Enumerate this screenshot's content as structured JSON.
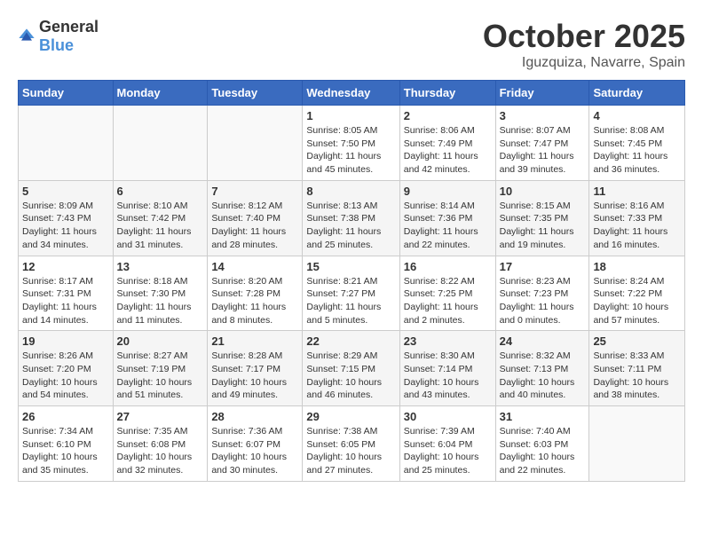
{
  "header": {
    "logo_general": "General",
    "logo_blue": "Blue",
    "month": "October 2025",
    "location": "Iguzquiza, Navarre, Spain"
  },
  "weekdays": [
    "Sunday",
    "Monday",
    "Tuesday",
    "Wednesday",
    "Thursday",
    "Friday",
    "Saturday"
  ],
  "weeks": [
    [
      {
        "day": "",
        "info": ""
      },
      {
        "day": "",
        "info": ""
      },
      {
        "day": "",
        "info": ""
      },
      {
        "day": "1",
        "info": "Sunrise: 8:05 AM\nSunset: 7:50 PM\nDaylight: 11 hours\nand 45 minutes."
      },
      {
        "day": "2",
        "info": "Sunrise: 8:06 AM\nSunset: 7:49 PM\nDaylight: 11 hours\nand 42 minutes."
      },
      {
        "day": "3",
        "info": "Sunrise: 8:07 AM\nSunset: 7:47 PM\nDaylight: 11 hours\nand 39 minutes."
      },
      {
        "day": "4",
        "info": "Sunrise: 8:08 AM\nSunset: 7:45 PM\nDaylight: 11 hours\nand 36 minutes."
      }
    ],
    [
      {
        "day": "5",
        "info": "Sunrise: 8:09 AM\nSunset: 7:43 PM\nDaylight: 11 hours\nand 34 minutes."
      },
      {
        "day": "6",
        "info": "Sunrise: 8:10 AM\nSunset: 7:42 PM\nDaylight: 11 hours\nand 31 minutes."
      },
      {
        "day": "7",
        "info": "Sunrise: 8:12 AM\nSunset: 7:40 PM\nDaylight: 11 hours\nand 28 minutes."
      },
      {
        "day": "8",
        "info": "Sunrise: 8:13 AM\nSunset: 7:38 PM\nDaylight: 11 hours\nand 25 minutes."
      },
      {
        "day": "9",
        "info": "Sunrise: 8:14 AM\nSunset: 7:36 PM\nDaylight: 11 hours\nand 22 minutes."
      },
      {
        "day": "10",
        "info": "Sunrise: 8:15 AM\nSunset: 7:35 PM\nDaylight: 11 hours\nand 19 minutes."
      },
      {
        "day": "11",
        "info": "Sunrise: 8:16 AM\nSunset: 7:33 PM\nDaylight: 11 hours\nand 16 minutes."
      }
    ],
    [
      {
        "day": "12",
        "info": "Sunrise: 8:17 AM\nSunset: 7:31 PM\nDaylight: 11 hours\nand 14 minutes."
      },
      {
        "day": "13",
        "info": "Sunrise: 8:18 AM\nSunset: 7:30 PM\nDaylight: 11 hours\nand 11 minutes."
      },
      {
        "day": "14",
        "info": "Sunrise: 8:20 AM\nSunset: 7:28 PM\nDaylight: 11 hours\nand 8 minutes."
      },
      {
        "day": "15",
        "info": "Sunrise: 8:21 AM\nSunset: 7:27 PM\nDaylight: 11 hours\nand 5 minutes."
      },
      {
        "day": "16",
        "info": "Sunrise: 8:22 AM\nSunset: 7:25 PM\nDaylight: 11 hours\nand 2 minutes."
      },
      {
        "day": "17",
        "info": "Sunrise: 8:23 AM\nSunset: 7:23 PM\nDaylight: 11 hours\nand 0 minutes."
      },
      {
        "day": "18",
        "info": "Sunrise: 8:24 AM\nSunset: 7:22 PM\nDaylight: 10 hours\nand 57 minutes."
      }
    ],
    [
      {
        "day": "19",
        "info": "Sunrise: 8:26 AM\nSunset: 7:20 PM\nDaylight: 10 hours\nand 54 minutes."
      },
      {
        "day": "20",
        "info": "Sunrise: 8:27 AM\nSunset: 7:19 PM\nDaylight: 10 hours\nand 51 minutes."
      },
      {
        "day": "21",
        "info": "Sunrise: 8:28 AM\nSunset: 7:17 PM\nDaylight: 10 hours\nand 49 minutes."
      },
      {
        "day": "22",
        "info": "Sunrise: 8:29 AM\nSunset: 7:15 PM\nDaylight: 10 hours\nand 46 minutes."
      },
      {
        "day": "23",
        "info": "Sunrise: 8:30 AM\nSunset: 7:14 PM\nDaylight: 10 hours\nand 43 minutes."
      },
      {
        "day": "24",
        "info": "Sunrise: 8:32 AM\nSunset: 7:13 PM\nDaylight: 10 hours\nand 40 minutes."
      },
      {
        "day": "25",
        "info": "Sunrise: 8:33 AM\nSunset: 7:11 PM\nDaylight: 10 hours\nand 38 minutes."
      }
    ],
    [
      {
        "day": "26",
        "info": "Sunrise: 7:34 AM\nSunset: 6:10 PM\nDaylight: 10 hours\nand 35 minutes."
      },
      {
        "day": "27",
        "info": "Sunrise: 7:35 AM\nSunset: 6:08 PM\nDaylight: 10 hours\nand 32 minutes."
      },
      {
        "day": "28",
        "info": "Sunrise: 7:36 AM\nSunset: 6:07 PM\nDaylight: 10 hours\nand 30 minutes."
      },
      {
        "day": "29",
        "info": "Sunrise: 7:38 AM\nSunset: 6:05 PM\nDaylight: 10 hours\nand 27 minutes."
      },
      {
        "day": "30",
        "info": "Sunrise: 7:39 AM\nSunset: 6:04 PM\nDaylight: 10 hours\nand 25 minutes."
      },
      {
        "day": "31",
        "info": "Sunrise: 7:40 AM\nSunset: 6:03 PM\nDaylight: 10 hours\nand 22 minutes."
      },
      {
        "day": "",
        "info": ""
      }
    ]
  ]
}
